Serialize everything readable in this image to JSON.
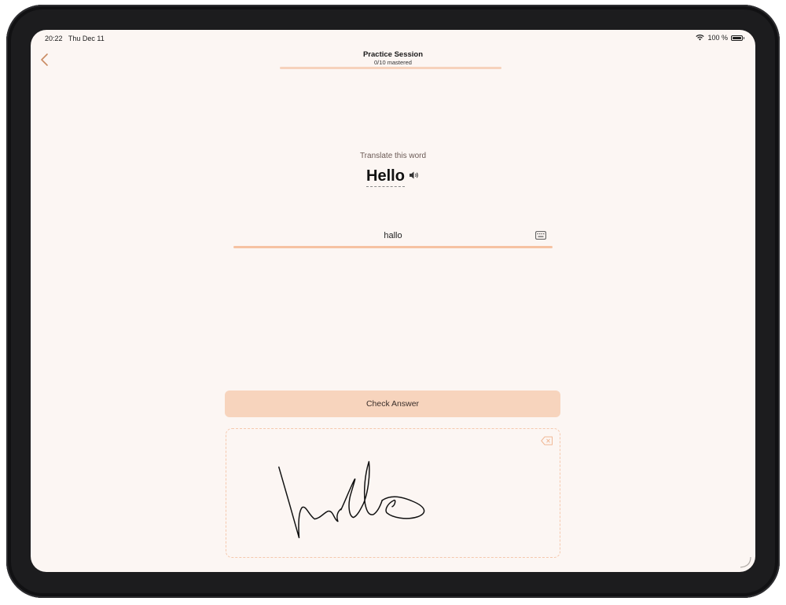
{
  "status_bar": {
    "time": "20:22",
    "date": "Thu Dec 11",
    "battery": "100 %",
    "battery_level": 1.0
  },
  "header": {
    "title": "Practice Session",
    "subtitle": "0/10 mastered",
    "progress": 0.0
  },
  "prompt": {
    "label": "Translate this word",
    "word": "Hello"
  },
  "answer": {
    "value": "hallo",
    "placeholder": ""
  },
  "actions": {
    "check_label": "Check Answer"
  },
  "icons": {
    "back": "chevron-left-icon",
    "speaker": "speaker-icon",
    "keyboard": "keyboard-icon",
    "clear": "delete-left-icon",
    "wifi": "wifi-icon",
    "battery": "battery-icon"
  },
  "colors": {
    "background": "#fcf6f3",
    "accent": "#f0a070",
    "progress_track": "#f6d2bc",
    "button": "#f7d4bd",
    "dashed_border": "#f5c8ad"
  }
}
